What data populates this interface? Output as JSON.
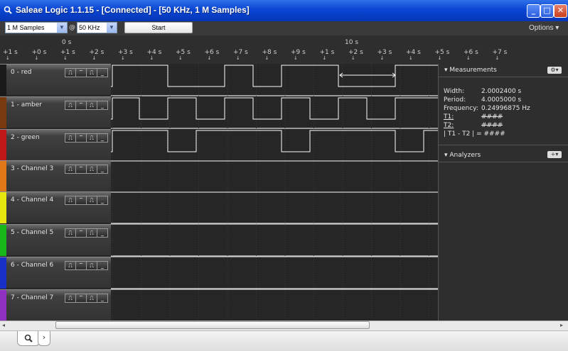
{
  "window": {
    "title": "Saleae Logic 1.1.15 - [Connected] - [50 KHz, 1 M Samples]",
    "minimize_glyph": "_",
    "maximize_glyph": "□",
    "close_glyph": "✕"
  },
  "toolbar": {
    "samples_value": "1 M Samples",
    "at_symbol": "@",
    "rate_value": "50 KHz",
    "start_label": "Start",
    "options_label": "Options ▾"
  },
  "ruler": {
    "major_labels": [
      "0 s",
      "10 s"
    ],
    "minor_labels": [
      "+1 s",
      "+0 s",
      "+1 s",
      "+2 s",
      "+3 s",
      "+4 s",
      "+5 s",
      "+6 s",
      "+7 s",
      "+8 s",
      "+9 s",
      "+1 s",
      "+2 s",
      "+3 s",
      "+4 s",
      "+5 s",
      "+6 s",
      "+7 s"
    ]
  },
  "channels": [
    {
      "name": "0 - red",
      "color": "#1a1a1a"
    },
    {
      "name": "1 - amber",
      "color": "#7a3a10"
    },
    {
      "name": "2 - green",
      "color": "#c01818"
    },
    {
      "name": "3 - Channel 3",
      "color": "#e07818"
    },
    {
      "name": "4 - Channel 4",
      "color": "#e8e810"
    },
    {
      "name": "5 - Channel 5",
      "color": "#18b818"
    },
    {
      "name": "6 - Channel 6",
      "color": "#1830c8"
    },
    {
      "name": "7 - Channel 7",
      "color": "#9030c0"
    }
  ],
  "trigger_buttons": [
    "⎍",
    "‾",
    "⎍",
    "_"
  ],
  "measurements": {
    "header": "Measurements",
    "gear": "⚙▾",
    "rows": [
      {
        "label": "Width:",
        "value": "2.0002400 s"
      },
      {
        "label": "Period:",
        "value": "4.0005000 s"
      },
      {
        "label": "Frequency:",
        "value": "0.24996875 Hz"
      },
      {
        "label": "T1:",
        "value": "####"
      },
      {
        "label": "T2:",
        "value": "####"
      },
      {
        "label": "| T1 - T2 | = ####",
        "value": ""
      }
    ]
  },
  "analyzers": {
    "header": "Analyzers",
    "add": "+▾"
  },
  "bottom_tabs": [
    "search-icon-tab",
    "›"
  ]
}
